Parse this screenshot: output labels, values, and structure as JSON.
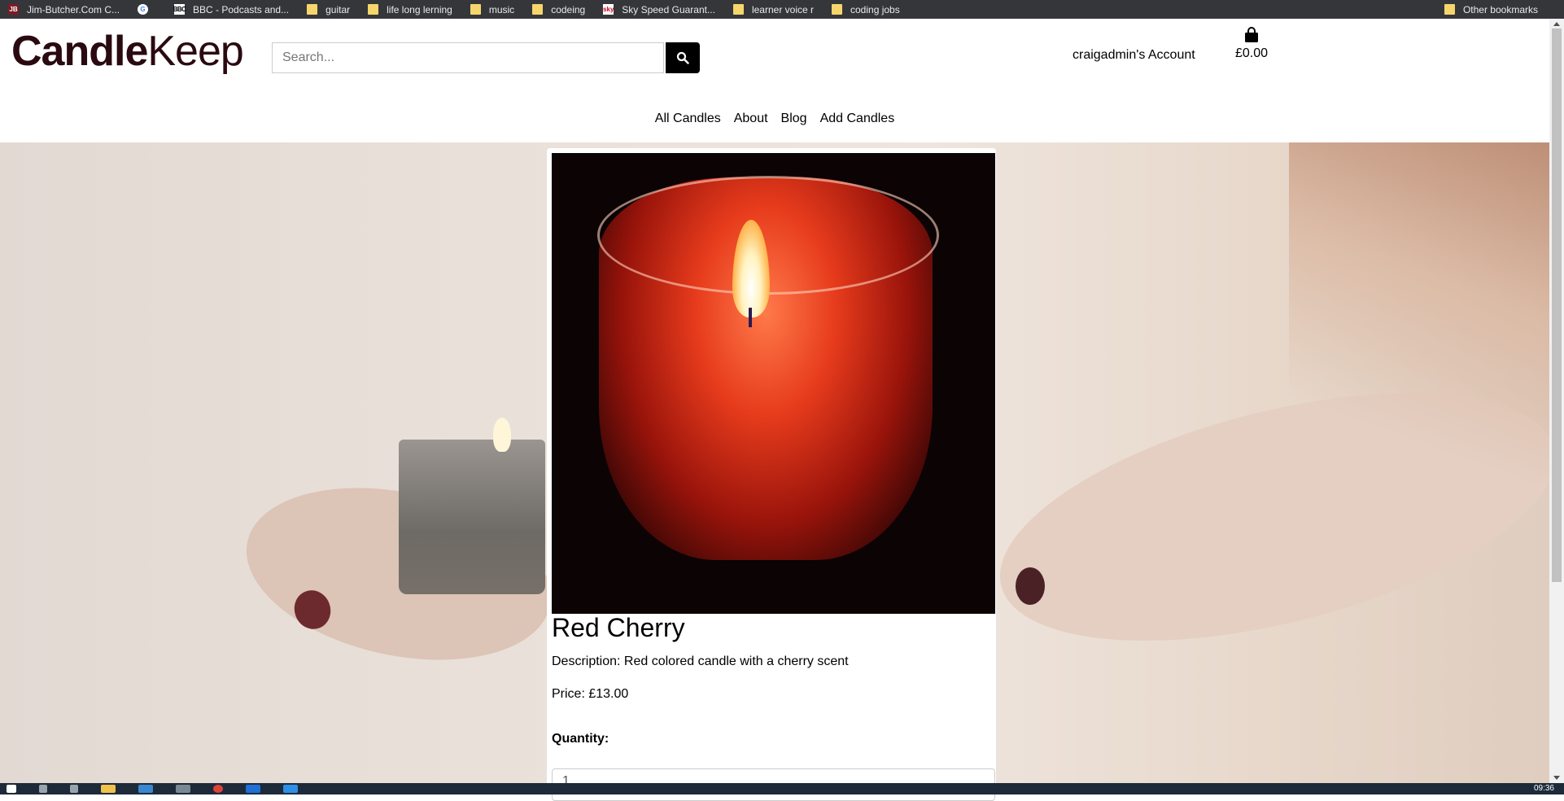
{
  "bookmarks": [
    {
      "label": "Jim-Butcher.Com C...",
      "icon": "jb-icon"
    },
    {
      "label": "",
      "icon": "google-icon"
    },
    {
      "label": "BBC - Podcasts and...",
      "icon": "bbc-icon"
    },
    {
      "label": "guitar",
      "icon": "folder-icon"
    },
    {
      "label": "life long lerning",
      "icon": "folder-icon"
    },
    {
      "label": "music",
      "icon": "folder-icon"
    },
    {
      "label": "codeing",
      "icon": "folder-icon"
    },
    {
      "label": "Sky Speed Guarant...",
      "icon": "sky-icon"
    },
    {
      "label": "learner voice r",
      "icon": "folder-icon"
    },
    {
      "label": "coding jobs",
      "icon": "folder-icon"
    }
  ],
  "other_bookmarks": "Other bookmarks",
  "header": {
    "logo_bold": "Candle",
    "logo_light": "Keep",
    "search_placeholder": "Search...",
    "account": "craigadmin's Account",
    "cart_total": "£0.00"
  },
  "nav": [
    "All Candles",
    "About",
    "Blog",
    "Add Candles"
  ],
  "product": {
    "title": "Red Cherry",
    "description": "Description: Red colored candle with a cherry scent",
    "price": "Price: £13.00",
    "quantity_label": "Quantity:",
    "quantity_value": "1"
  },
  "taskbar": {
    "clock": "09:36"
  },
  "colors": {
    "logo": "#2a0a10",
    "search_button": "#000000",
    "bookmarks_bar": "#35363a"
  }
}
